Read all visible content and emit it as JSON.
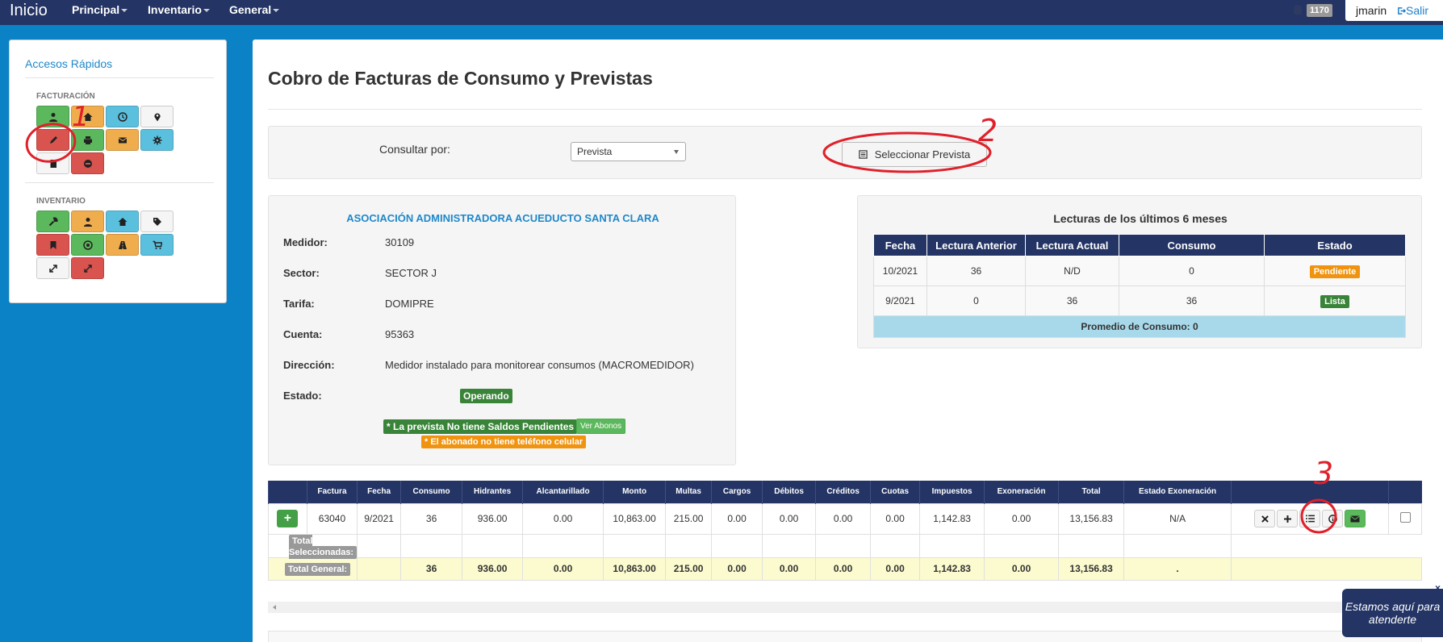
{
  "navbar": {
    "brand": "Inicio",
    "menu": [
      "Principal",
      "Inventario",
      "General"
    ],
    "notifications": "1170",
    "user": "jmarin",
    "logout": "Salir"
  },
  "sidebar": {
    "title": "Accesos Rápidos",
    "sections": [
      {
        "label": "FACTURACIÓN",
        "buttons": [
          {
            "icon": "user-icon",
            "color": "#5cb85c"
          },
          {
            "icon": "home-icon",
            "color": "#f0ad4e"
          },
          {
            "icon": "clock-icon",
            "color": "#5bc0de"
          },
          {
            "icon": "map-marker-icon",
            "color": "#f5f5f5"
          },
          {
            "icon": "pencil-icon",
            "color": "#d9534f"
          },
          {
            "icon": "print-icon",
            "color": "#5cb85c"
          },
          {
            "icon": "envelope-icon",
            "color": "#f0ad4e"
          },
          {
            "icon": "gear-icon",
            "color": "#5bc0de"
          },
          {
            "icon": "file-icon",
            "color": "#f5f5f5"
          },
          {
            "icon": "circle-icon",
            "color": "#d9534f"
          }
        ]
      },
      {
        "label": "INVENTARIO",
        "buttons": [
          {
            "icon": "wrench-icon",
            "color": "#5cb85c"
          },
          {
            "icon": "user-icon",
            "color": "#f0ad4e"
          },
          {
            "icon": "home-icon",
            "color": "#5bc0de"
          },
          {
            "icon": "tag-icon",
            "color": "#f5f5f5"
          },
          {
            "icon": "bookmark-icon",
            "color": "#d9534f"
          },
          {
            "icon": "target-icon",
            "color": "#5cb85c"
          },
          {
            "icon": "road-icon",
            "color": "#f0ad4e"
          },
          {
            "icon": "cart-icon",
            "color": "#5bc0de"
          },
          {
            "icon": "resize-icon",
            "color": "#f5f5f5"
          },
          {
            "icon": "expand-icon",
            "color": "#d9534f"
          }
        ]
      }
    ]
  },
  "page": {
    "title": "Cobro de Facturas de Consumo y Previstas"
  },
  "query": {
    "label": "Consultar por:",
    "selected": "Prevista",
    "button": "Seleccionar Prevista"
  },
  "info": {
    "association": "ASOCIACIÓN ADMINISTRADORA ACUEDUCTO SANTA CLARA",
    "fields": [
      {
        "label": "Medidor:",
        "value": "30109"
      },
      {
        "label": "Sector:",
        "value": "SECTOR J"
      },
      {
        "label": "Tarifa:",
        "value": "DOMIPRE"
      },
      {
        "label": "Cuenta:",
        "value": "95363"
      },
      {
        "label": "Dirección:",
        "value": "Medidor instalado para monitorear consumos (MACROMEDIDOR)"
      }
    ],
    "estado_label": "Estado:",
    "estado_value": "Operando",
    "no_saldos": "* La prevista No tiene Saldos Pendientes",
    "ver_abonos": "Ver Abonos",
    "no_telefono": "* El abonado no tiene teléfono celular"
  },
  "lecturas": {
    "title": "Lecturas de los últimos 6 meses",
    "headers": [
      "Fecha",
      "Lectura Anterior",
      "Lectura Actual",
      "Consumo",
      "Estado"
    ],
    "rows": [
      {
        "fecha": "10/2021",
        "anterior": "36",
        "actual": "N/D",
        "consumo": "0",
        "estado": "Pendiente"
      },
      {
        "fecha": "9/2021",
        "anterior": "0",
        "actual": "36",
        "consumo": "36",
        "estado": "Lista"
      }
    ],
    "promedio": "Promedio de Consumo: 0"
  },
  "facturas": {
    "headers": [
      "Factura",
      "Fecha",
      "Consumo",
      "Hidrantes",
      "Alcantarillado",
      "Monto",
      "Multas",
      "Cargos",
      "Débitos",
      "Créditos",
      "Cuotas",
      "Impuestos",
      "Exoneración",
      "Total",
      "Estado Exoneración"
    ],
    "row": [
      "63040",
      "9/2021",
      "36",
      "936.00",
      "0.00",
      "10,863.00",
      "215.00",
      "0.00",
      "0.00",
      "0.00",
      "0.00",
      "1,142.83",
      "0.00",
      "13,156.83",
      "N/A"
    ],
    "total_seleccionadas": "Total Seleccionadas:",
    "total_general_label": "Total General:",
    "total_general": [
      "36",
      "936.00",
      "0.00",
      "10,863.00",
      "215.00",
      "0.00",
      "0.00",
      "0.00",
      "0.00",
      "1,142.83",
      "0.00",
      "13,156.83",
      "."
    ],
    "add_symbol": "+"
  },
  "annotations": [
    "1",
    "2",
    "3"
  ],
  "chat": {
    "line1": "Estamos aquí para",
    "line2": "atenderte",
    "close": "×"
  }
}
